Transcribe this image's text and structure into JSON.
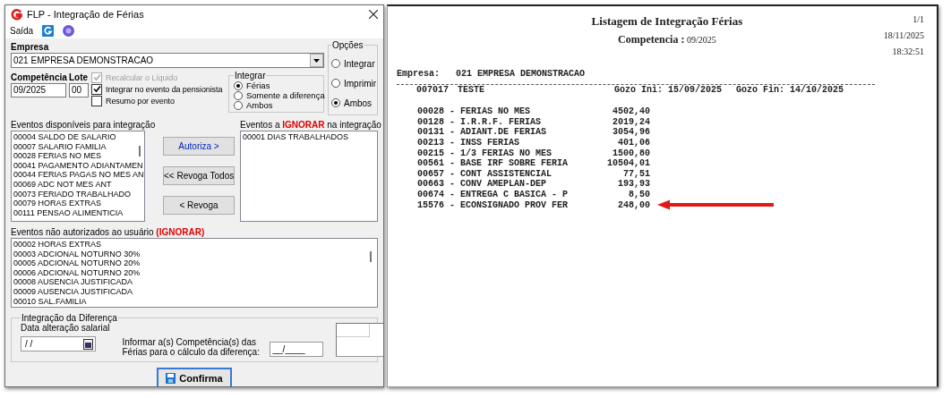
{
  "dialog": {
    "title": "FLP - Integração de Férias",
    "menu": "Saída",
    "empresa": {
      "label": "Empresa",
      "value": "021 EMPRESA DEMONSTRACAO"
    },
    "competencia": {
      "label": "Competência",
      "value": "09/2025"
    },
    "lote": {
      "label": "Lote",
      "value": "00"
    },
    "checkboxes": [
      {
        "label": "Recalcular o Líquido",
        "checked": true,
        "disabled": true
      },
      {
        "label": "Integrar no evento da pensionista",
        "checked": true,
        "disabled": false
      },
      {
        "label": "Resumo por evento",
        "checked": false,
        "disabled": false
      }
    ],
    "integrar": {
      "title": "Integrar",
      "options": [
        {
          "label": "Férias",
          "selected": true
        },
        {
          "label": "Somente a diferença",
          "selected": false
        },
        {
          "label": "Ambos",
          "selected": false
        }
      ]
    },
    "opcoes": {
      "title": "Opções",
      "options": [
        {
          "label": "Integrar",
          "selected": false
        },
        {
          "label": "Imprimir",
          "selected": false
        },
        {
          "label": "Ambos",
          "selected": true
        }
      ]
    },
    "available": {
      "label": "Eventos disponíveis para integração",
      "items": [
        "00004 SALDO DE SALARIO",
        "00007 SALARIO FAMILIA",
        "00028 FERIAS NO MES",
        "00041 PAGAMENTO ADIANTAMEN",
        "00044 FERIAS PAGAS NO MES AN",
        "00069 ADC NOT MES ANT",
        "00073 FERIADO TRABALHADO",
        "00079 HORAS EXTRAS",
        "00111 PENSAO ALIMENTICIA"
      ]
    },
    "ignore": {
      "label": "Eventos a **IGNORAR** na integração",
      "items": [
        "00001 DIAS TRABALHADOS"
      ]
    },
    "buttons": [
      "Autoriza >",
      "<< Revoga Todos",
      "< Revoga"
    ],
    "unauthorized": {
      "label": "Eventos não autorizados ao usuário **(IGNORAR)**",
      "items": [
        "00002 HORAS EXTRAS",
        "00003 ADCIONAL NOTURNO 30%",
        "00005 ADCIONAL NOTURNO 20%",
        "00006 ADCIONAL NOTURNO 20%",
        "00008 AUSENCIA JUSTIFICADA",
        "00009 AUSENCIA JUSTIFICADA",
        "00010 SAL.FAMILIA"
      ]
    },
    "diferenca": {
      "title": "Integração da Diferença",
      "date_label": "Data alteração salarial",
      "date_value": "/ /",
      "comp_label": "Informar a(s) Competência(s) das Férias para o cálculo da diferença:",
      "comp_value": "__/____"
    },
    "confirm": "Confirma"
  },
  "report": {
    "title": "Listagem de Integração Férias",
    "competencia_label": "Competencia :",
    "competencia": "09/2025",
    "page": "1/1",
    "date": "18/11/2025",
    "time": "18:32:51",
    "empresa_label": "Empresa:",
    "empresa": "021 EMPRESA DEMONSTRACAO",
    "employee": {
      "code": "007017",
      "name": "TESTE",
      "gozo_ini": "Gozo Ini: 15/09/2025",
      "gozo_fin": "Gozo Fin: 14/10/2025"
    },
    "rows": [
      {
        "event": "00028 - FERIAS NO MES",
        "value": "4502,40",
        "highlighted": false
      },
      {
        "event": "00128 - I.R.R.F. FERIAS",
        "value": "2019,24",
        "highlighted": false
      },
      {
        "event": "00131 - ADIANT.DE FERIAS",
        "value": "3054,96",
        "highlighted": false
      },
      {
        "event": "00213 - INSS FERIAS",
        "value": "401,06",
        "highlighted": false
      },
      {
        "event": "00215 - 1/3 FERIAS NO MES",
        "value": "1500,80",
        "highlighted": false
      },
      {
        "event": "00561 - BASE IRF SOBRE FERIA",
        "value": "10504,01",
        "highlighted": false
      },
      {
        "event": "00657 - CONT ASSISTENCIAL",
        "value": "77,51",
        "highlighted": false
      },
      {
        "event": "00663 - CONV AMEPLAN-DEP",
        "value": "193,93",
        "highlighted": false
      },
      {
        "event": "00674 - ENTREGA C BASICA - P",
        "value": "8,50",
        "highlighted": false
      },
      {
        "event": "15576 - ECONSIGNADO PROV FER",
        "value": "248,00",
        "highlighted": true
      }
    ]
  }
}
